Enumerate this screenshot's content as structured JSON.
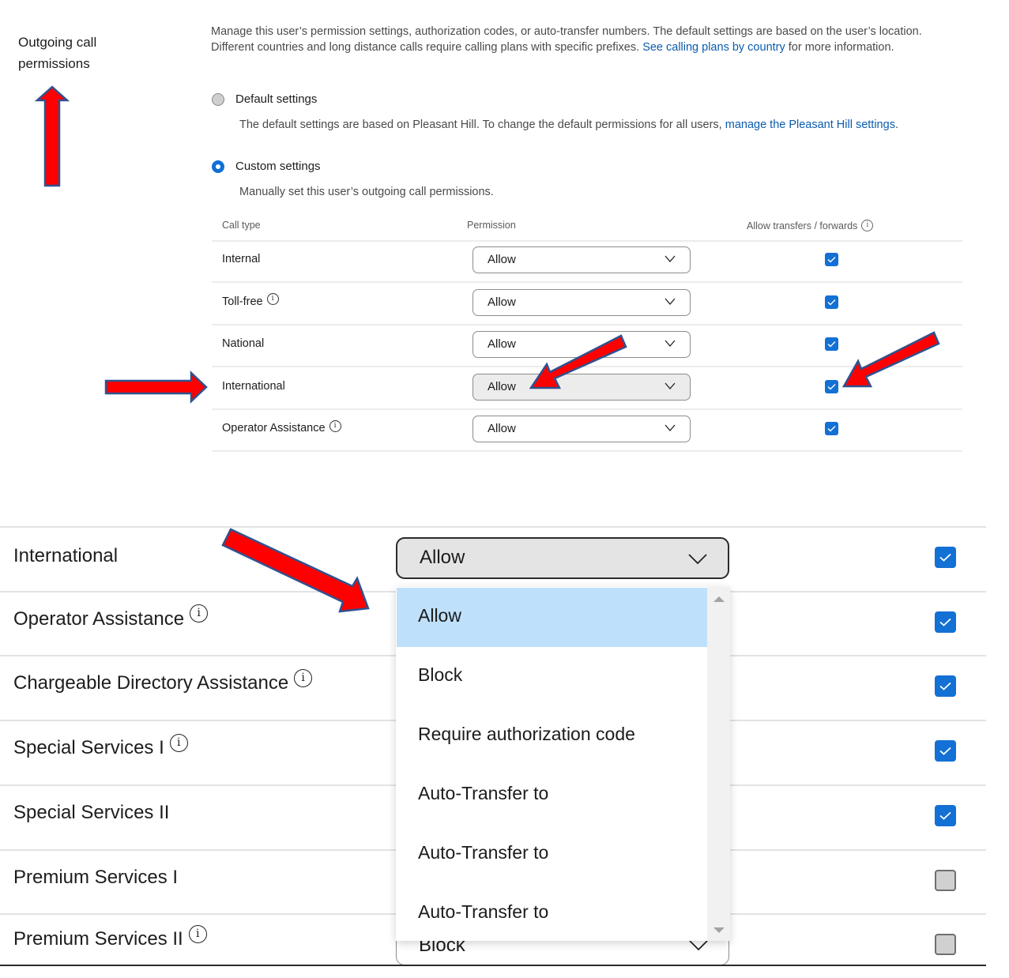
{
  "section": {
    "title": "Outgoing call permissions"
  },
  "intro": {
    "text": "Manage this user’s permission settings, authorization codes, or auto-transfer numbers. The default settings are based on the user’s location. Different countries and long distance calls require calling plans with specific prefixes. ",
    "link": "See calling plans by country",
    "suffix": " for more information."
  },
  "settings_mode": {
    "default": {
      "label": "Default settings",
      "selected": false,
      "desc": "The default settings are based on Pleasant Hill. To change the default permissions for all users, ",
      "desc_link": "manage the Pleasant Hill settings",
      "desc_suffix": "."
    },
    "custom": {
      "label": "Custom settings",
      "selected": true,
      "desc": "Manually set this user’s outgoing call permissions."
    }
  },
  "table": {
    "headers": {
      "call_type": "Call type",
      "permission": "Permission",
      "allow_transfers": "Allow transfers / forwards"
    },
    "rows": [
      {
        "call_type": "Internal",
        "info": false,
        "permission": "Allow",
        "allow_transfers": true
      },
      {
        "call_type": "Toll-free",
        "info": true,
        "permission": "Allow",
        "allow_transfers": true
      },
      {
        "call_type": "National",
        "info": false,
        "permission": "Allow",
        "allow_transfers": true
      },
      {
        "call_type": "International",
        "info": false,
        "permission": "Allow",
        "allow_transfers": true,
        "highlighted": true
      },
      {
        "call_type": "Operator Assistance",
        "info": true,
        "permission": "Allow",
        "allow_transfers": true
      }
    ]
  },
  "zoomed": {
    "rows": [
      {
        "call_type": "International",
        "info": false,
        "permission": "Allow",
        "allow_transfers": true
      },
      {
        "call_type": "Operator Assistance",
        "info": true,
        "allow_transfers": true
      },
      {
        "call_type": "Chargeable Directory Assistance",
        "info": true,
        "allow_transfers": true
      },
      {
        "call_type": "Special Services I",
        "info": true,
        "allow_transfers": true
      },
      {
        "call_type": "Special Services II",
        "info": false,
        "allow_transfers": true
      },
      {
        "call_type": "Premium Services I",
        "info": false,
        "allow_transfers": false
      },
      {
        "call_type": "Premium Services II",
        "info": true,
        "permission": "Block",
        "allow_transfers": false
      }
    ],
    "dropdown": {
      "selected": "Allow",
      "options": [
        "Allow",
        "Block",
        "Require authorization code",
        "Auto-Transfer to",
        "Auto-Transfer to",
        "Auto-Transfer to"
      ]
    }
  },
  "colors": {
    "accent": "#1370d4",
    "link": "#0b5cad",
    "option_highlight": "#bfe0fb",
    "annotation_arrow": "#ff0000",
    "annotation_outline": "#2f528f"
  }
}
